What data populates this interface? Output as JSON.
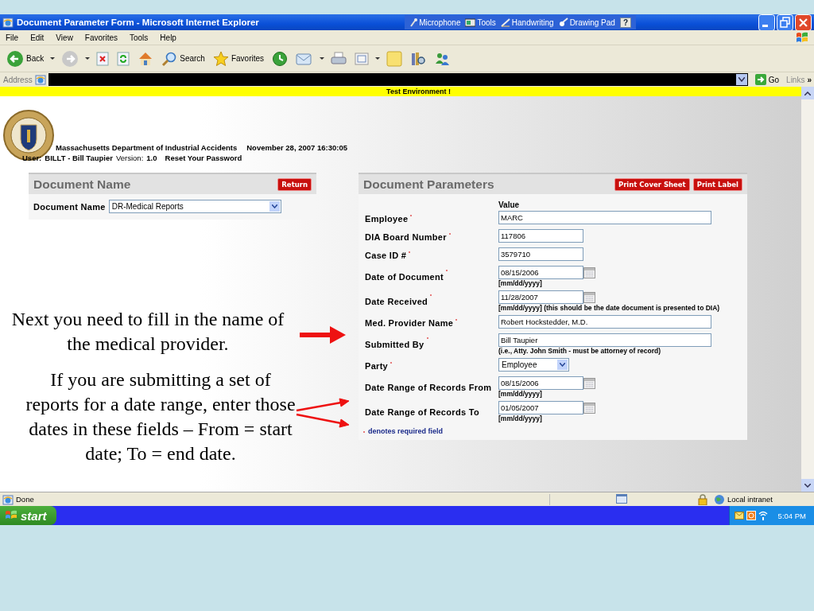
{
  "window": {
    "title": "Document Parameter Form - Microsoft Internet Explorer"
  },
  "language_bar": [
    {
      "kind": "microphone",
      "label": "Microphone"
    },
    {
      "kind": "tools",
      "label": "Tools"
    },
    {
      "kind": "handwriting",
      "label": "Handwriting"
    },
    {
      "kind": "drawing",
      "label": "Drawing Pad"
    }
  ],
  "help_label": "?",
  "menu": [
    "File",
    "Edit",
    "View",
    "Favorites",
    "Tools",
    "Help"
  ],
  "toolbar": [
    {
      "kind": "back",
      "label": "Back",
      "dropdown": true
    },
    {
      "kind": "forward",
      "dropdown": true
    },
    {
      "kind": "stop"
    },
    {
      "kind": "refresh"
    },
    {
      "kind": "home"
    },
    {
      "kind": "search",
      "label": "Search"
    },
    {
      "kind": "favorites",
      "label": "Favorites"
    },
    {
      "kind": "history"
    },
    {
      "kind": "mail",
      "dropdown": true
    },
    {
      "kind": "print"
    },
    {
      "kind": "edit",
      "dropdown": true
    },
    {
      "kind": "note"
    },
    {
      "kind": "research"
    },
    {
      "kind": "messenger"
    }
  ],
  "address_bar": {
    "label": "Address",
    "go": "Go",
    "links": "Links",
    "more": "»"
  },
  "banner": "Test Environment !",
  "header": {
    "agency": "Massachusetts Department of Industrial Accidents",
    "datetime": "November 28, 2007 16:30:05",
    "user_label": "User:",
    "user": "BILLT  -  Bill Taupier",
    "version_label": "Version:",
    "version": "1.0",
    "reset_link": "Reset Your Password"
  },
  "document_name_panel": {
    "title": "Document Name",
    "return_button": "Return",
    "field_label": "Document Name",
    "value": "DR-Medical Reports"
  },
  "parameters_panel": {
    "title": "Document Parameters",
    "buttons": [
      "Print Cover Sheet",
      "Print Label"
    ],
    "value_heading": "Value",
    "fields": [
      {
        "kind": "wide",
        "label": "Employee",
        "required": true,
        "value": "MARC"
      },
      {
        "kind": "short",
        "label": "DIA Board Number",
        "required": true,
        "value": "117806"
      },
      {
        "kind": "short",
        "label": "Case ID #",
        "required": true,
        "value": "3579710"
      },
      {
        "kind": "date",
        "label": "Date of Document",
        "required": true,
        "value": "08/15/2006",
        "hint": "[mm/dd/yyyy]"
      },
      {
        "kind": "date",
        "label": "Date Received",
        "required": true,
        "value": "11/28/2007",
        "hint": "[mm/dd/yyyy] (this should be the date document is presented to DIA)"
      },
      {
        "kind": "wide",
        "label": "Med. Provider Name",
        "required": true,
        "value": "Robert Hockstedder, M.D."
      },
      {
        "kind": "wide",
        "label": "Submitted By",
        "required": true,
        "value": "Bill Taupier",
        "hint": "(i.e., Atty. John Smith - must be attorney of record)"
      },
      {
        "kind": "select",
        "label": "Party",
        "required": true,
        "value": "Employee"
      },
      {
        "kind": "date",
        "label": "Date Range of Records From",
        "required": false,
        "value": "08/15/2006",
        "hint": "[mm/dd/yyyy]"
      },
      {
        "kind": "date",
        "label": "Date Range of Records To",
        "required": false,
        "value": "01/05/2007",
        "hint": "[mm/dd/yyyy]"
      }
    ],
    "required_note": "denotes required field"
  },
  "annotations": [
    {
      "kind": "single",
      "text": "Next you need to fill in the name of the medical provider."
    },
    {
      "kind": "double",
      "text": "If you are submitting a set of reports for a date range, enter those dates in these fields – From = start date; To = end date."
    }
  ],
  "status_bar": {
    "text": "Done",
    "zone": "Local intranet"
  },
  "taskbar": {
    "start": "start",
    "clock": "5:04 PM"
  }
}
